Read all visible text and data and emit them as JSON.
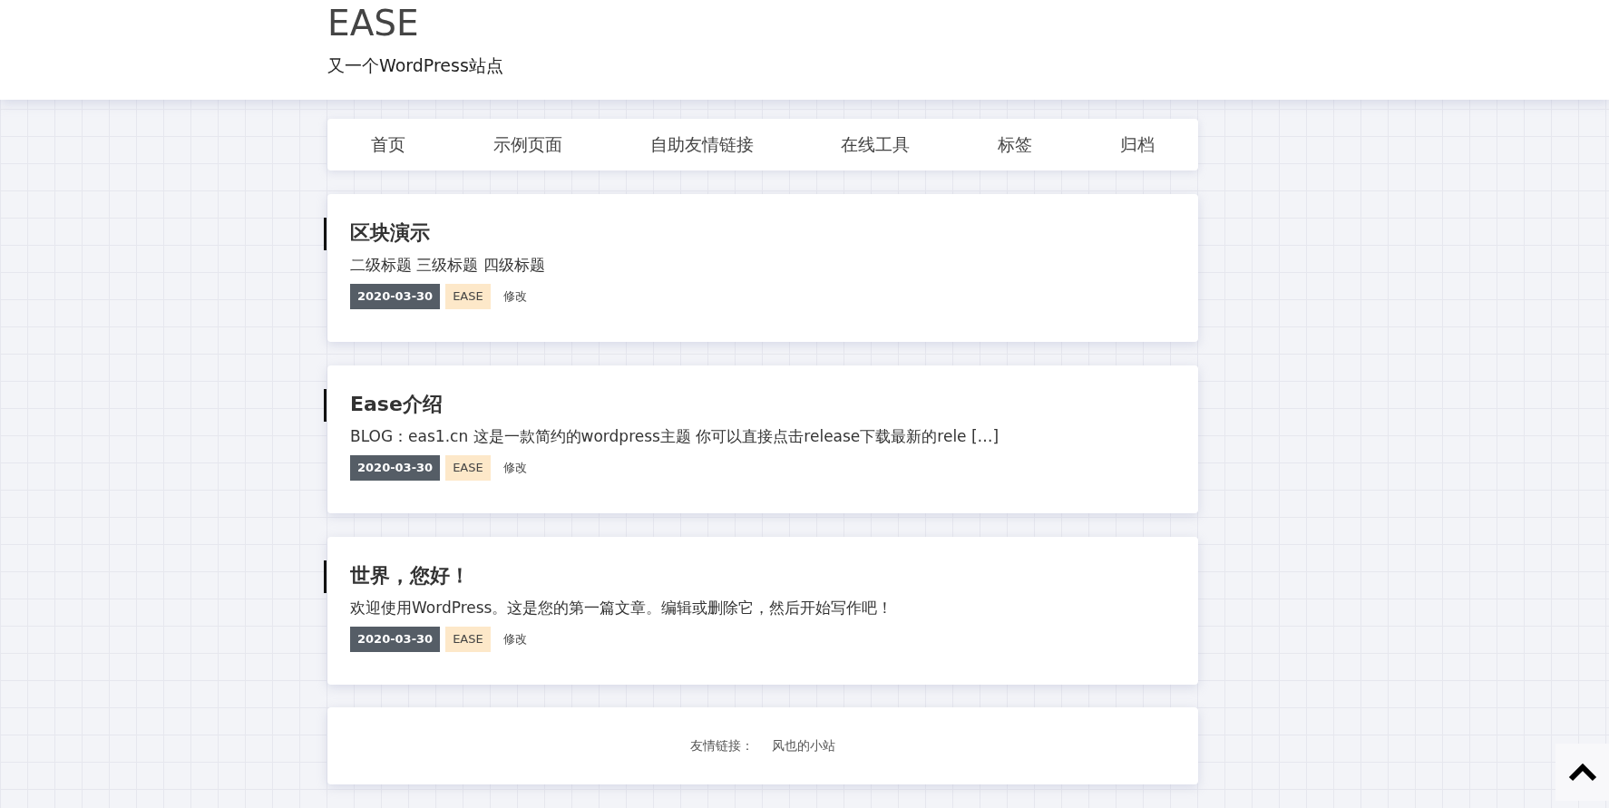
{
  "site": {
    "title": "EASE",
    "tagline": "又一个WordPress站点"
  },
  "nav": [
    {
      "label": "首页"
    },
    {
      "label": "示例页面"
    },
    {
      "label": "自助友情链接"
    },
    {
      "label": "在线工具"
    },
    {
      "label": "标签"
    },
    {
      "label": "归档"
    }
  ],
  "posts": [
    {
      "title": "区块演示",
      "excerpt": "二级标题 三级标题 四级标题",
      "date": "2020-03-30",
      "category": "EASE",
      "edit": "修改"
    },
    {
      "title": "Ease介绍",
      "excerpt": "BLOG：eas1.cn 这是一款简约的wordpress主题 你可以直接点击release下载最新的rele […]",
      "date": "2020-03-30",
      "category": "EASE",
      "edit": "修改"
    },
    {
      "title": "世界，您好！",
      "excerpt": "欢迎使用WordPress。这是您的第一篇文章。编辑或删除它，然后开始写作吧！",
      "date": "2020-03-30",
      "category": "EASE",
      "edit": "修改"
    }
  ],
  "footer": {
    "label": "友情链接：",
    "links": [
      {
        "label": "风也的小站"
      }
    ]
  }
}
